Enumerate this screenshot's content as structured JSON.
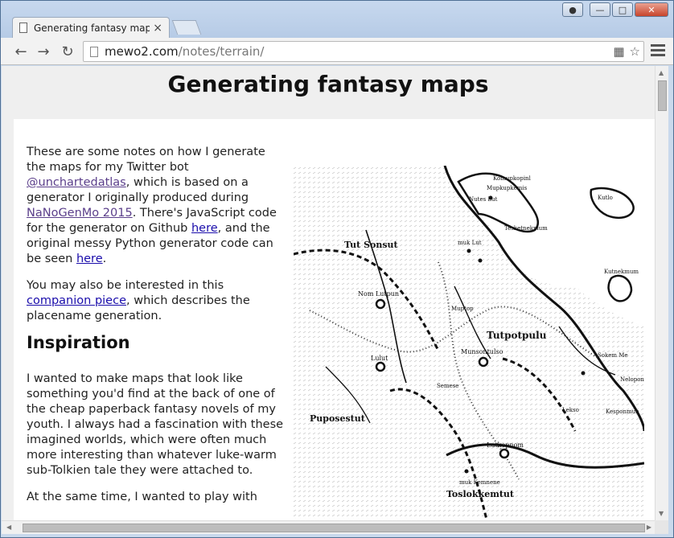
{
  "browser": {
    "tab_title": "Generating fantasy maps",
    "tab_close": "×",
    "url_host": "mewo2.com",
    "url_path": "/notes/terrain/",
    "nav": {
      "back": "←",
      "forward": "→",
      "reload": "↻"
    },
    "icons": [
      "document-icon",
      "translate-icon",
      "star-icon",
      "menu-icon"
    ]
  },
  "page": {
    "title": "Generating fantasy maps",
    "intro": {
      "t1": "These are some notes on how I generate the maps for my Twitter bot ",
      "link1": "@unchartedatlas",
      "t2": ", which is based on a generator I originally produced during ",
      "link2": "NaNoGenMo 2015",
      "t3": ". There's JavaScript code for the generator on Github ",
      "link3": "here",
      "t4": ", and the original messy Python generator code can be seen ",
      "link4": "here",
      "t5": "."
    },
    "para2": {
      "t1": "You may also be interested in this ",
      "link": "companion piece",
      "t2": ", which describes the placename generation."
    },
    "section_heading": "Inspiration",
    "para3": "I wanted to make maps that look like something you'd find at the back of one of the cheap paperback fantasy novels of my youth. I always had a fascination with these imagined worlds, which were often much more interesting than whatever luke-warm sub-Tolkien tale they were attached to.",
    "para4": "At the same time, I wanted to play with"
  },
  "map": {
    "regions": [
      "Tut Sonsut",
      "Tutpotpulu",
      "Puposestut",
      "Toslokkemtut"
    ],
    "towns": [
      "Nom Lutpun",
      "Lulut",
      "Munsontulso",
      "Lutkopnom"
    ],
    "places": [
      "Komupkopinl",
      "Mupkupkemis",
      "Nutes Lut",
      "Tesketnekmum",
      "Kutlo",
      "muk Lut",
      "Kutnekmum",
      "Muptop",
      "Sokem Me",
      "Nelopon",
      "Semese",
      "Lekso",
      "Kesponmun",
      "muk Kemnene"
    ]
  }
}
